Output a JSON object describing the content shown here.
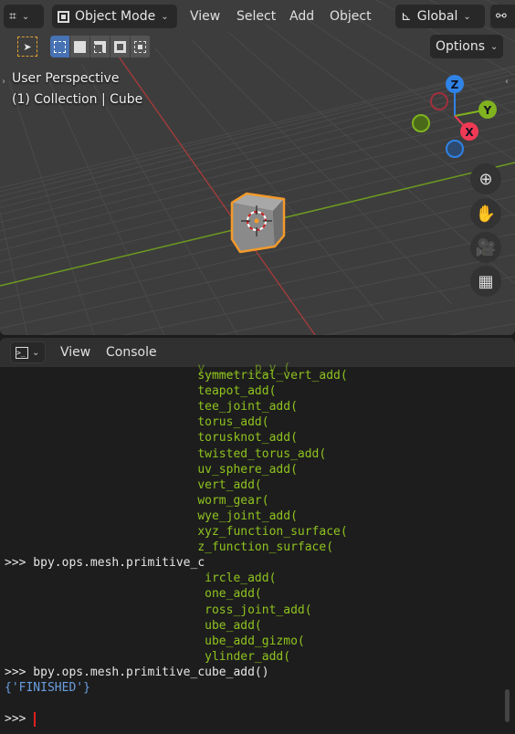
{
  "viewport": {
    "header": {
      "mode": "Object Mode",
      "menus": [
        "View",
        "Select",
        "Add",
        "Object"
      ],
      "orientation": "Global",
      "options": "Options"
    },
    "overlay": {
      "perspective": "User Perspective",
      "collection": "(1) Collection | Cube"
    },
    "gizmo": {
      "x": "X",
      "y": "Y",
      "z": "Z",
      "colors": {
        "x": "#f03a55",
        "y": "#80b31f",
        "z": "#2f83e6"
      }
    },
    "nav_icons": [
      "zoom-icon",
      "hand-pan-icon",
      "camera-icon",
      "grid-ortho-icon"
    ]
  },
  "console": {
    "header": {
      "menus": [
        "View",
        "Console"
      ]
    },
    "lines": [
      {
        "text": "                           symmetrical_vert_add(",
        "cls": "g"
      },
      {
        "text": "                           teapot_add(",
        "cls": "g"
      },
      {
        "text": "                           tee_joint_add(",
        "cls": "g"
      },
      {
        "text": "                           torus_add(",
        "cls": "g"
      },
      {
        "text": "                           torusknot_add(",
        "cls": "g"
      },
      {
        "text": "                           twisted_torus_add(",
        "cls": "g"
      },
      {
        "text": "                           uv_sphere_add(",
        "cls": "g"
      },
      {
        "text": "                           vert_add(",
        "cls": "g"
      },
      {
        "text": "                           worm_gear(",
        "cls": "g"
      },
      {
        "text": "                           wye_joint_add(",
        "cls": "g"
      },
      {
        "text": "                           xyz_function_surface(",
        "cls": "g"
      },
      {
        "text": "                           z_function_surface(",
        "cls": "g"
      },
      {
        "text": ">>> bpy.ops.mesh.primitive_c",
        "cls": "w"
      },
      {
        "text": "                            ircle_add(",
        "cls": "g"
      },
      {
        "text": "                            one_add(",
        "cls": "g"
      },
      {
        "text": "                            ross_joint_add(",
        "cls": "g"
      },
      {
        "text": "                            ube_add(",
        "cls": "g"
      },
      {
        "text": "                            ube_add_gizmo(",
        "cls": "g"
      },
      {
        "text": "                            ylinder_add(",
        "cls": "g"
      },
      {
        "text": ">>> bpy.ops.mesh.primitive_cube_add()",
        "cls": "w"
      },
      {
        "text": "{'FINISHED'}",
        "cls": "b"
      },
      {
        "text": "",
        "cls": "w"
      },
      {
        "text": ">>> ",
        "cls": "w"
      }
    ],
    "cursor_color": "#e02020"
  }
}
